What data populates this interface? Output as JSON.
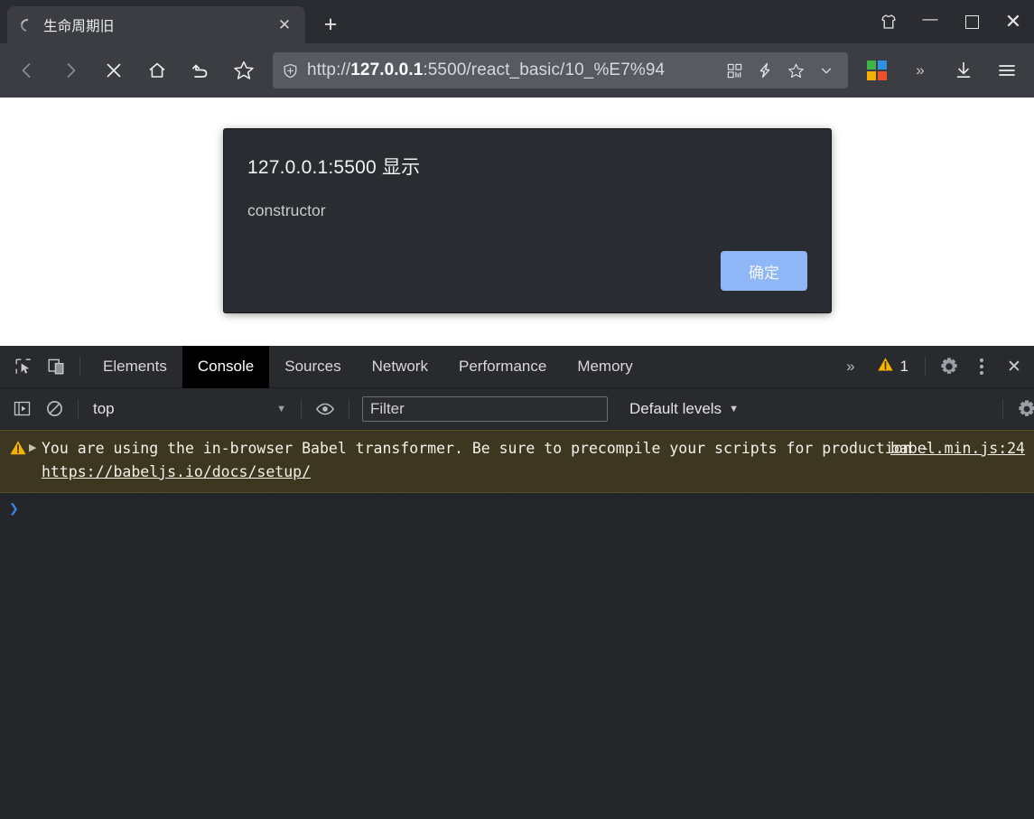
{
  "browser": {
    "window_controls": [
      {
        "name": "skin-icon",
        "label": ""
      },
      {
        "name": "minimize-button",
        "label": "—"
      },
      {
        "name": "maximize-button",
        "label": ""
      },
      {
        "name": "close-window-button",
        "label": "✕"
      }
    ],
    "tab": {
      "title": "生命周期旧",
      "close_label": "✕",
      "loading": true
    },
    "new_tab_label": "+",
    "nav": {
      "back_label": "‹",
      "forward_label": "›",
      "stop_label": "✕",
      "home_label": "",
      "refresh_label": "",
      "favorite_label": ""
    },
    "omnibox": {
      "url_prefix": "http://",
      "url_host": "127.0.0.1",
      "url_suffix": ":5500/react_basic/10_%E7%94",
      "full_url": "http://127.0.0.1:5500/react_basic/10_%E7%94",
      "icons": [
        "qr-code-icon",
        "lightning-icon",
        "star-icon",
        "chevron-down-icon"
      ]
    },
    "toolbar_right": {
      "extension_colors": [
        "#3db34a",
        "#2f8fe0",
        "#f2b004",
        "#e9522a"
      ],
      "overflow_label": "»",
      "downloads_label": "",
      "menu_label": ""
    }
  },
  "dialog": {
    "title": "127.0.0.1:5500 显示",
    "message": "constructor",
    "ok_label": "确定",
    "accent": "#8fb6f6",
    "background": "#292c31"
  },
  "devtools": {
    "tabs": [
      {
        "label": "Elements",
        "active": false
      },
      {
        "label": "Console",
        "active": true
      },
      {
        "label": "Sources",
        "active": false
      },
      {
        "label": "Network",
        "active": false
      },
      {
        "label": "Performance",
        "active": false
      },
      {
        "label": "Memory",
        "active": false
      }
    ],
    "more_tabs_label": "»",
    "warning_count": "1",
    "settings_label": "",
    "more_options_label": "",
    "close_label": "✕",
    "console_toolbar": {
      "sidebar_toggle_name": "console-sidebar-toggle",
      "clear_console_name": "clear-console-icon",
      "context": "top",
      "context_caret": "▼",
      "live_expression_name": "eye-icon",
      "filter_value": "Filter",
      "filter_placeholder": "Filter",
      "levels": "Default levels",
      "levels_caret": "▼",
      "settings_right_name": "console-settings-gear-icon"
    },
    "messages": [
      {
        "type": "warning",
        "expand_label": "▶",
        "text_part1": "You are using the in-browser Babel transformer. Be sure to precompile your scripts for production - ",
        "link_text": "https://babeljs.io/docs/setup/",
        "source": "babel.min.js:24",
        "background": "#3d3722"
      }
    ],
    "prompt": {
      "chevron": "❯",
      "value": ""
    }
  }
}
